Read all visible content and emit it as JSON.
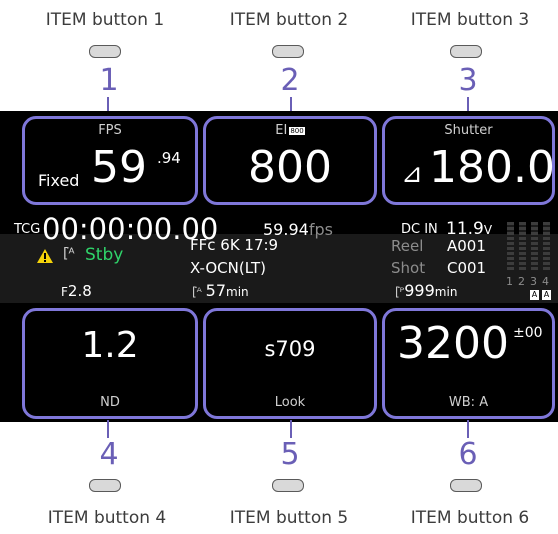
{
  "item_buttons": [
    {
      "label": "ITEM button 1",
      "number": "1"
    },
    {
      "label": "ITEM button 2",
      "number": "2"
    },
    {
      "label": "ITEM button 3",
      "number": "3"
    },
    {
      "label": "ITEM button 4",
      "number": "4"
    },
    {
      "label": "ITEM button 5",
      "number": "5"
    },
    {
      "label": "ITEM button 6",
      "number": "6"
    }
  ],
  "top_panels": {
    "fps": {
      "label": "FPS",
      "mode": "Fixed",
      "value": "59",
      "decimal": ".94"
    },
    "ei": {
      "label": "EI",
      "tag": "800",
      "value": "800"
    },
    "shutter": {
      "label": "Shutter",
      "symbol": "⊿",
      "value": "180.0"
    }
  },
  "status": {
    "tc_label": "TCG",
    "timecode": "00:00:00.00",
    "fps_value": "59.94",
    "fps_unit": "fps",
    "dc_label": "DC IN",
    "dc_value": "11.9",
    "dc_unit": "V",
    "warning_icon": "warning-triangle",
    "media_a_icon": "media-a-icon",
    "rec_state": "Stby",
    "format_line1": "FFc 6K 17:9",
    "format_line2": "X-OCN(LT)",
    "reel_label": "Reel",
    "reel_value": "A001",
    "shot_label": "Shot",
    "shot_value": "C001",
    "iris_prefix": "F",
    "iris_value": "2.8",
    "remain_value": "57",
    "remain_unit": "min",
    "proxy_value": "999",
    "proxy_unit": "min",
    "audio_channels": [
      "1",
      "2",
      "3",
      "4"
    ],
    "audio_tags": [
      "A",
      "A"
    ]
  },
  "bottom_panels": {
    "nd": {
      "value": "1.2",
      "label": "ND"
    },
    "look": {
      "value": "s709",
      "label": "Look"
    },
    "wb": {
      "value": "3200",
      "offset": "±00",
      "label": "WB: A"
    }
  },
  "colors": {
    "accent": "#6a5fb6",
    "panel_border": "#7f77d9",
    "standby": "#2fd36a",
    "warning": "#f5d30a"
  }
}
